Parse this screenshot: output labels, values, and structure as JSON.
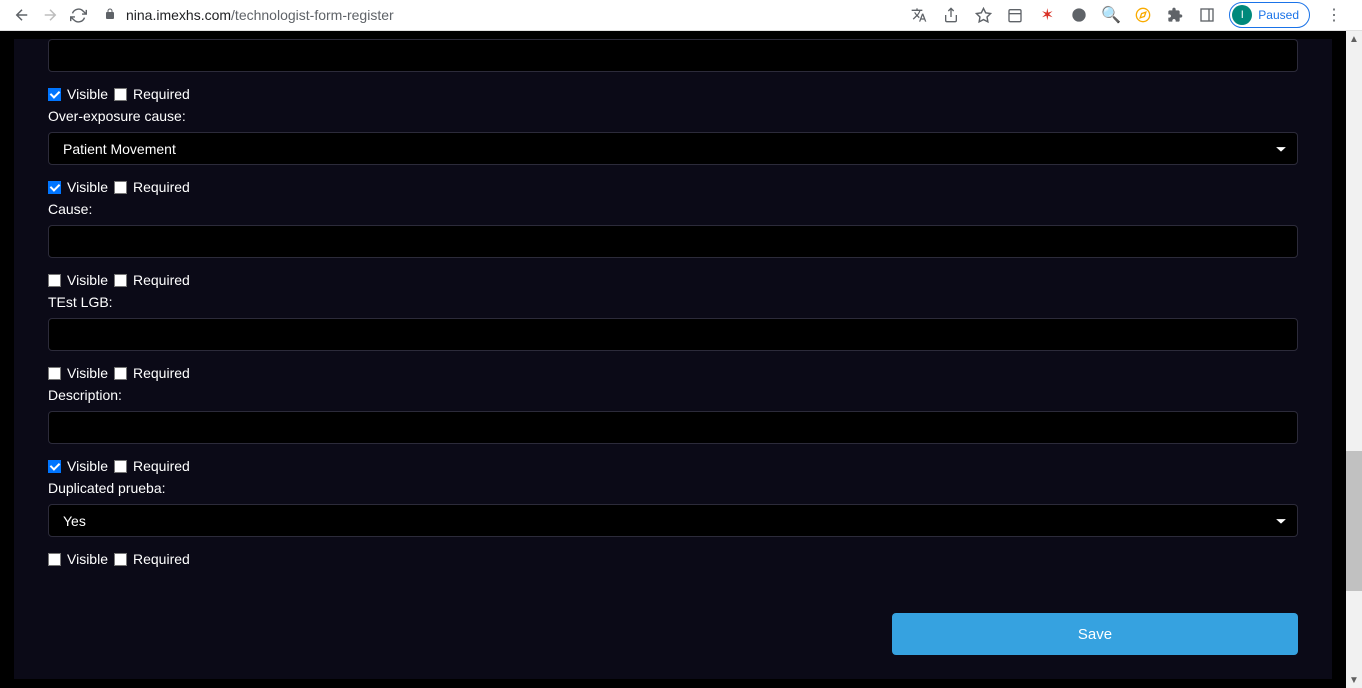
{
  "browser": {
    "url_domain": "nina.imexhs.com",
    "url_path": "/technologist-form-register",
    "profile_status": "Paused",
    "profile_initial": "I"
  },
  "labels": {
    "visible": "Visible",
    "required": "Required"
  },
  "fields": [
    {
      "visible_checked": true,
      "required_checked": false,
      "label": "Over-exposure cause:",
      "type": "select",
      "value": "Patient Movement"
    },
    {
      "visible_checked": true,
      "required_checked": false,
      "label": "Cause:",
      "type": "text",
      "value": ""
    },
    {
      "visible_checked": false,
      "required_checked": false,
      "label": "TEst LGB:",
      "type": "text",
      "value": ""
    },
    {
      "visible_checked": false,
      "required_checked": false,
      "label": "Description:",
      "type": "text",
      "value": ""
    },
    {
      "visible_checked": true,
      "required_checked": false,
      "label": "Duplicated prueba:",
      "type": "select",
      "value": "Yes"
    },
    {
      "visible_checked": false,
      "required_checked": false,
      "label": "",
      "type": "none",
      "value": ""
    }
  ],
  "buttons": {
    "save": "Save"
  }
}
